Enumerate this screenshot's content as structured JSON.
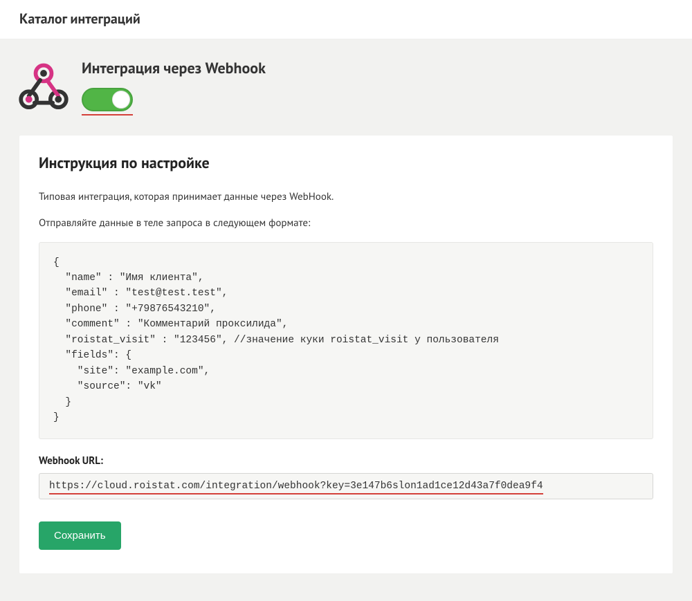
{
  "topbar": {
    "title": "Каталог интеграций"
  },
  "header": {
    "title": "Интеграция через Webhook",
    "toggle_on": true
  },
  "card": {
    "heading": "Инструкция по настройке",
    "desc1": "Типовая интеграция, которая принимает данные через WebHook.",
    "desc2": "Отправляйте данные в теле запроса в следующем формате:",
    "code": "{\n  \"name\" : \"Имя клиента\",\n  \"email\" : \"test@test.test\",\n  \"phone\" : \"+79876543210\",\n  \"comment\" : \"Комментарий проксилида\",\n  \"roistat_visit\" : \"123456\", //значение куки roistat_visit у пользователя\n  \"fields\": {\n    \"site\": \"example.com\",\n    \"source\": \"vk\"\n  }\n}",
    "url_label": "Webhook URL:",
    "url_value": "https://cloud.roistat.com/integration/webhook?key=3e147b6slon1ad1ce12d43a7f0dea9f4",
    "save_label": "Сохранить"
  }
}
